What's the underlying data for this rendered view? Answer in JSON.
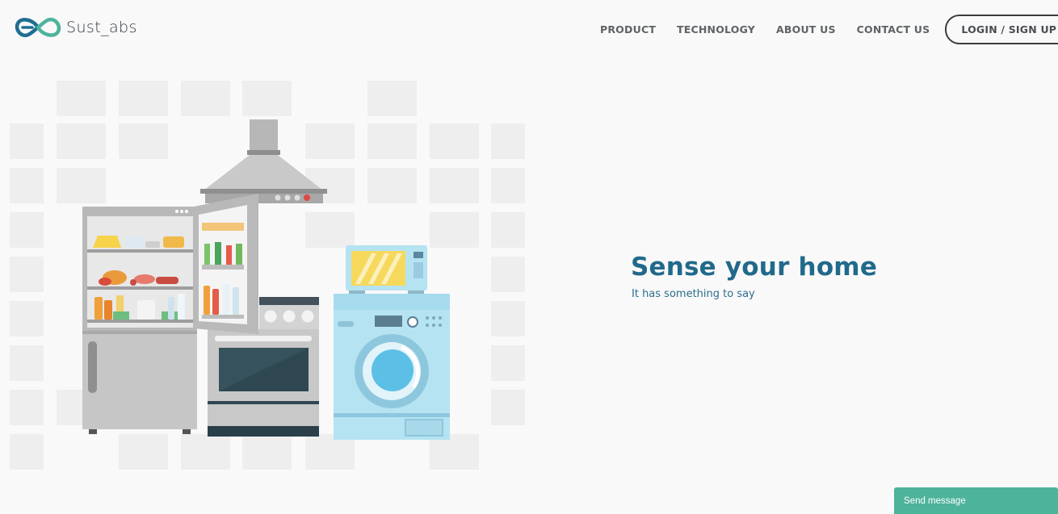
{
  "header": {
    "logo_text": "Sust_abs",
    "nav": {
      "product": "PRODUCT",
      "technology": "TECHNOLOGY",
      "about": "ABOUT US",
      "contact": "CONTACT US",
      "login": "LOGIN / SIGN UP"
    }
  },
  "hero": {
    "title": "Sense your home",
    "subtitle": "It has something to say"
  },
  "chat": {
    "label": "Send message"
  },
  "colors": {
    "brand_teal": "#4db39b",
    "brand_blue": "#21698b",
    "washer_blue": "#b5e3f2",
    "appliance_gray": "#c4c4c4"
  },
  "icons": {
    "logo": "infinity-logo-icon"
  }
}
